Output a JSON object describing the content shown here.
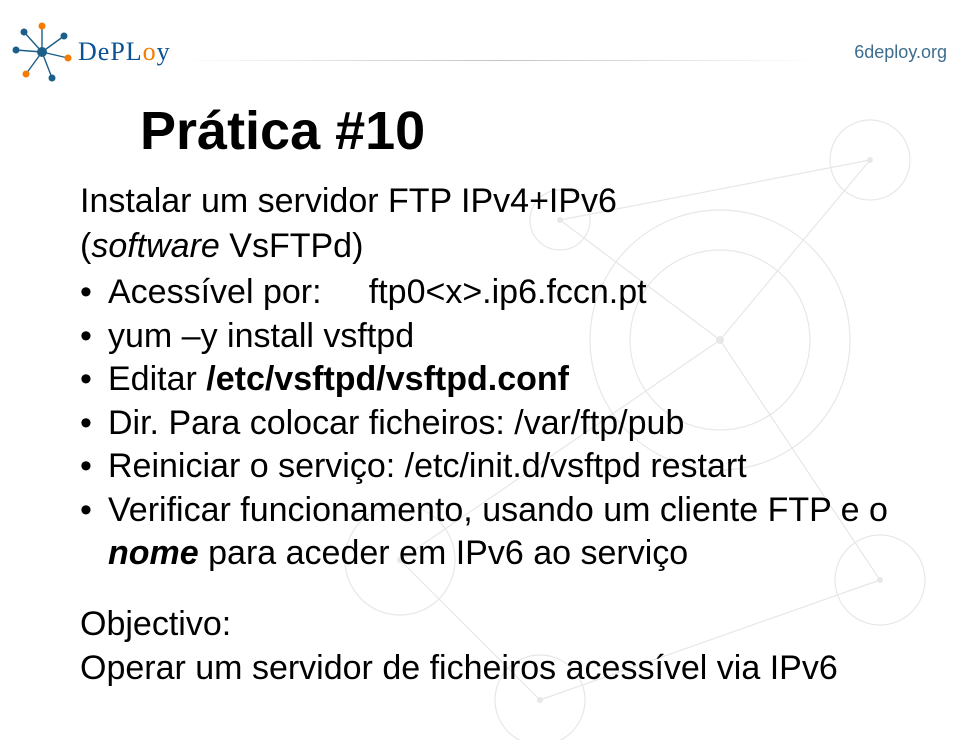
{
  "header": {
    "logo_text_prefix": "DeP",
    "logo_text_mid": "L",
    "logo_text_o": "o",
    "logo_text_suffix": "y",
    "site": "6deploy.org"
  },
  "slide": {
    "title": "Prática #10",
    "subtitle_line1": "Instalar um servidor FTP IPv4+IPv6",
    "subtitle_line2_open": "(",
    "subtitle_line2_italic": "software",
    "subtitle_line2_rest": " VsFTPd)",
    "bullets": [
      {
        "text": "Acessível por:     ftp0<x>.ip6.fccn.pt"
      },
      {
        "text": "yum –y install vsftpd"
      },
      {
        "plain": "Editar ",
        "bold": "/etc/vsftpd/vsftpd.conf"
      },
      {
        "text": "Dir. Para colocar ficheiros: /var/ftp/pub"
      },
      {
        "text": "Reiniciar o serviço: /etc/init.d/vsftpd restart"
      },
      {
        "plain": "Verificar funcionamento, usando um cliente FTP e o ",
        "italic_bold": "nome",
        "rest": " para aceder em IPv6 ao serviço"
      }
    ],
    "objective_label": "Objectivo:",
    "objective_text": "Operar um servidor de ficheiros acessível via IPv6"
  }
}
